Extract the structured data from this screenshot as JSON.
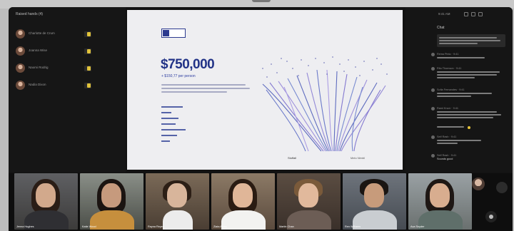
{
  "window": {
    "chat_header": "9:41 AM"
  },
  "participants": {
    "title": "Raised hands (4)",
    "items": [
      {
        "name": "Charlotte de Crum"
      },
      {
        "name": "Joanna Wise"
      },
      {
        "name": "Naomi Rodrig"
      },
      {
        "name": "Nadia Dixon"
      }
    ]
  },
  "slide": {
    "amount": "$750,000",
    "sub_amount": "+ $150,77 per person",
    "footer_left": "Stoffall",
    "footer_right": "Melo Nimbl"
  },
  "chat": {
    "title": "Chat",
    "messages": [
      {
        "who": ""
      },
      {
        "who": "Reina Pinto · 9:41"
      },
      {
        "who": "Ritu Thomson · 9:41"
      },
      {
        "who": "Sofia Fernandes · 9:41"
      },
      {
        "who": "Rami Knorr · 9:41"
      },
      {
        "who": "Self Rash · 9:41"
      },
      {
        "who": "Self Rash · 9:41"
      }
    ],
    "last_text": "Sounds good"
  },
  "videos": [
    {
      "name": "Jenna Hughes"
    },
    {
      "name": "Katie Wood"
    },
    {
      "name": "Rayna Reyes"
    },
    {
      "name": "Zlata Aleks"
    },
    {
      "name": "Martin Chan"
    },
    {
      "name": "Ren Williams"
    },
    {
      "name": "Ava Snyder"
    }
  ],
  "colors": {
    "accent": "#223387",
    "highlight": "#e0c23a",
    "background": "#121212"
  }
}
